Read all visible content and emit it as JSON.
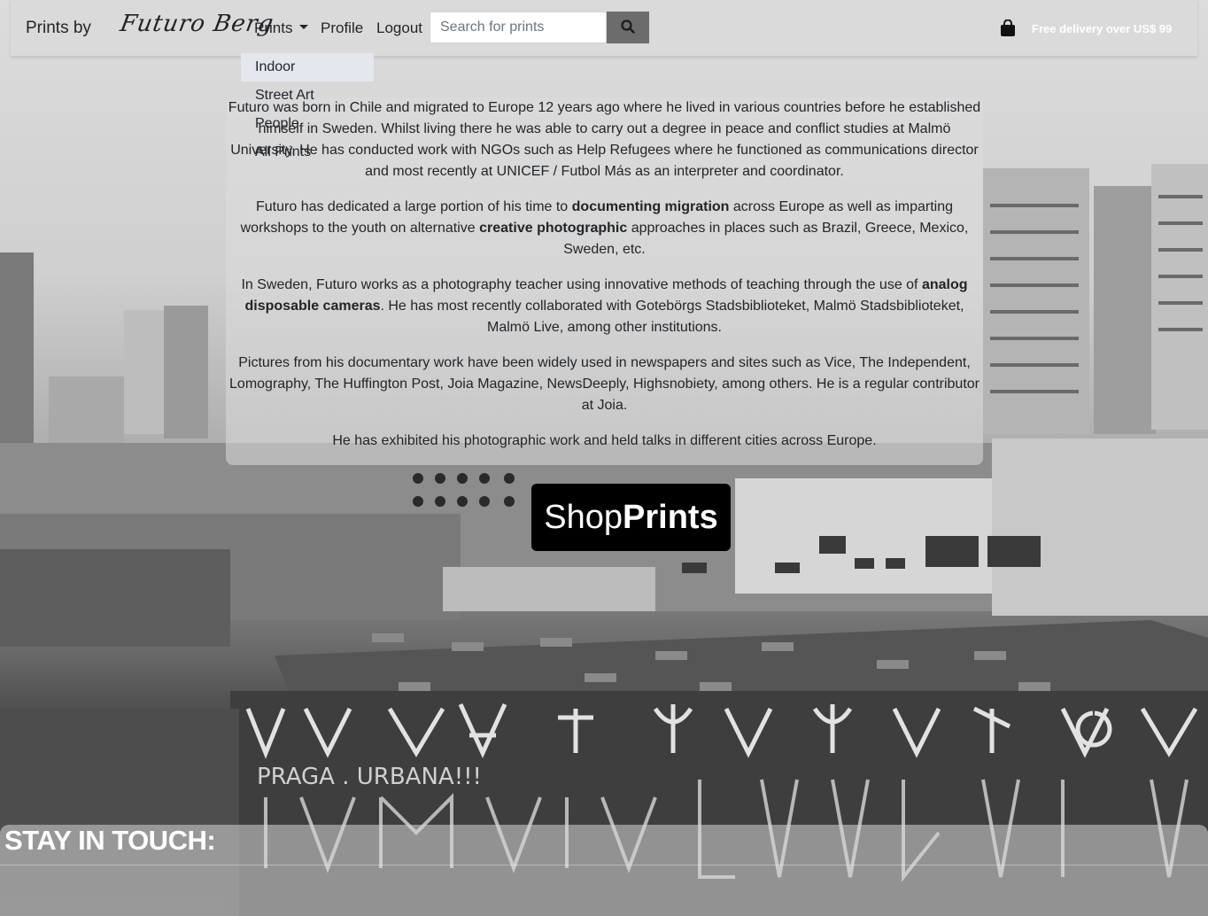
{
  "navbar": {
    "brand_prefix": "Prints by",
    "signature": "Futuro Berg",
    "prints_label": "Prints",
    "profile_label": "Profile",
    "logout_label": "Logout",
    "search_placeholder": "Search for prints",
    "search_icon": "magnifier-icon",
    "bag_icon": "shopping-bag-icon",
    "delivery_text": "Free delivery over US$ 99"
  },
  "dropdown": {
    "items": [
      {
        "label": "Indoor",
        "active": true
      },
      {
        "label": "Street Art",
        "active": false
      },
      {
        "label": "People",
        "active": false
      },
      {
        "label": "All Prints",
        "active": false
      }
    ]
  },
  "about": {
    "p1": "Futuro was born in Chile and migrated to Europe 12 years ago where he lived in various countries before he established himself in Sweden. Whilst living there he was able to carry out a degree in peace and conflict studies at Malmö University. He has conducted work with NGOs such as Help Refugees where he functioned as communications director and most recently at UNICEF / Futbol Más as an interpreter and coordinator.",
    "p2_a": "Futuro has dedicated a large portion of his time to ",
    "p2_b": "documenting migration",
    "p2_c": " across Europe as well as imparting workshops to the youth on alternative ",
    "p2_d": "creative photographic",
    "p2_e": " approaches in places such as Brazil, Greece, Mexico, Sweden, etc.",
    "p3_a": "In Sweden, Futuro works as a photography teacher using innovative methods of teaching through the use of ",
    "p3_b": "analog disposable cameras",
    "p3_c": ". He has most recently collaborated with Gotebörgs Stadsbiblioteket, Malmö Stadsbiblioteket, Malmö Live, among other institutions.",
    "p4": "Pictures from his documentary work have been widely used in newspapers and sites such as Vice, The Independent, Lomography, The Huffington Post, Joia Magazine, NewsDeeply, Highsnobiety, among others. He is a regular contributor at Joia.",
    "p5": "He has exhibited his photographic work and held talks in different cities across Europe."
  },
  "shop_button": {
    "part1": "Shop",
    "part2": "Prints"
  },
  "footer": {
    "heading": "STAY IN TOUCH:"
  },
  "colors": {
    "navbar_bg": "#dadada",
    "search_button": "#6c6c6c",
    "shop_button_bg": "#000000",
    "dropdown_active": "#e4e7ee",
    "delivery_text": "#ffffff"
  }
}
